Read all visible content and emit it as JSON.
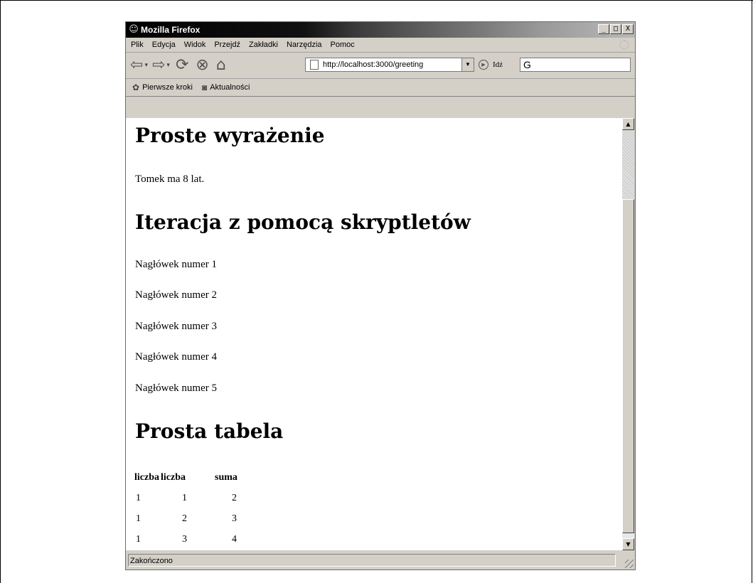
{
  "window": {
    "title": "Mozilla Firefox",
    "controls": [
      "_",
      "□",
      "X"
    ]
  },
  "menu": [
    "Plik",
    "Edycja",
    "Widok",
    "Przejdź",
    "Zakładki",
    "Narzędzia",
    "Pomoc"
  ],
  "toolbar": {
    "url": "http://localhost:3000/greeting",
    "go_label": "Idź",
    "search_value": "G"
  },
  "bookmarks": [
    "Pierwsze kroki",
    "Aktualności"
  ],
  "page": {
    "h1_expression": "Proste wyrażenie",
    "expression_text": "Tomek ma 8 lat.",
    "h1_iteration": "Iteracja z pomocą skryptletów",
    "headings": [
      "Nagłówek numer 1",
      "Nagłówek numer 2",
      "Nagłówek numer 3",
      "Nagłówek numer 4",
      "Nagłówek numer 5"
    ],
    "h1_table": "Prosta tabela",
    "table": {
      "headers": [
        "liczba",
        "liczba",
        "suma"
      ],
      "rows": [
        [
          "1",
          "1",
          "2"
        ],
        [
          "1",
          "2",
          "3"
        ],
        [
          "1",
          "3",
          "4"
        ]
      ]
    }
  },
  "status": "Zakończono"
}
